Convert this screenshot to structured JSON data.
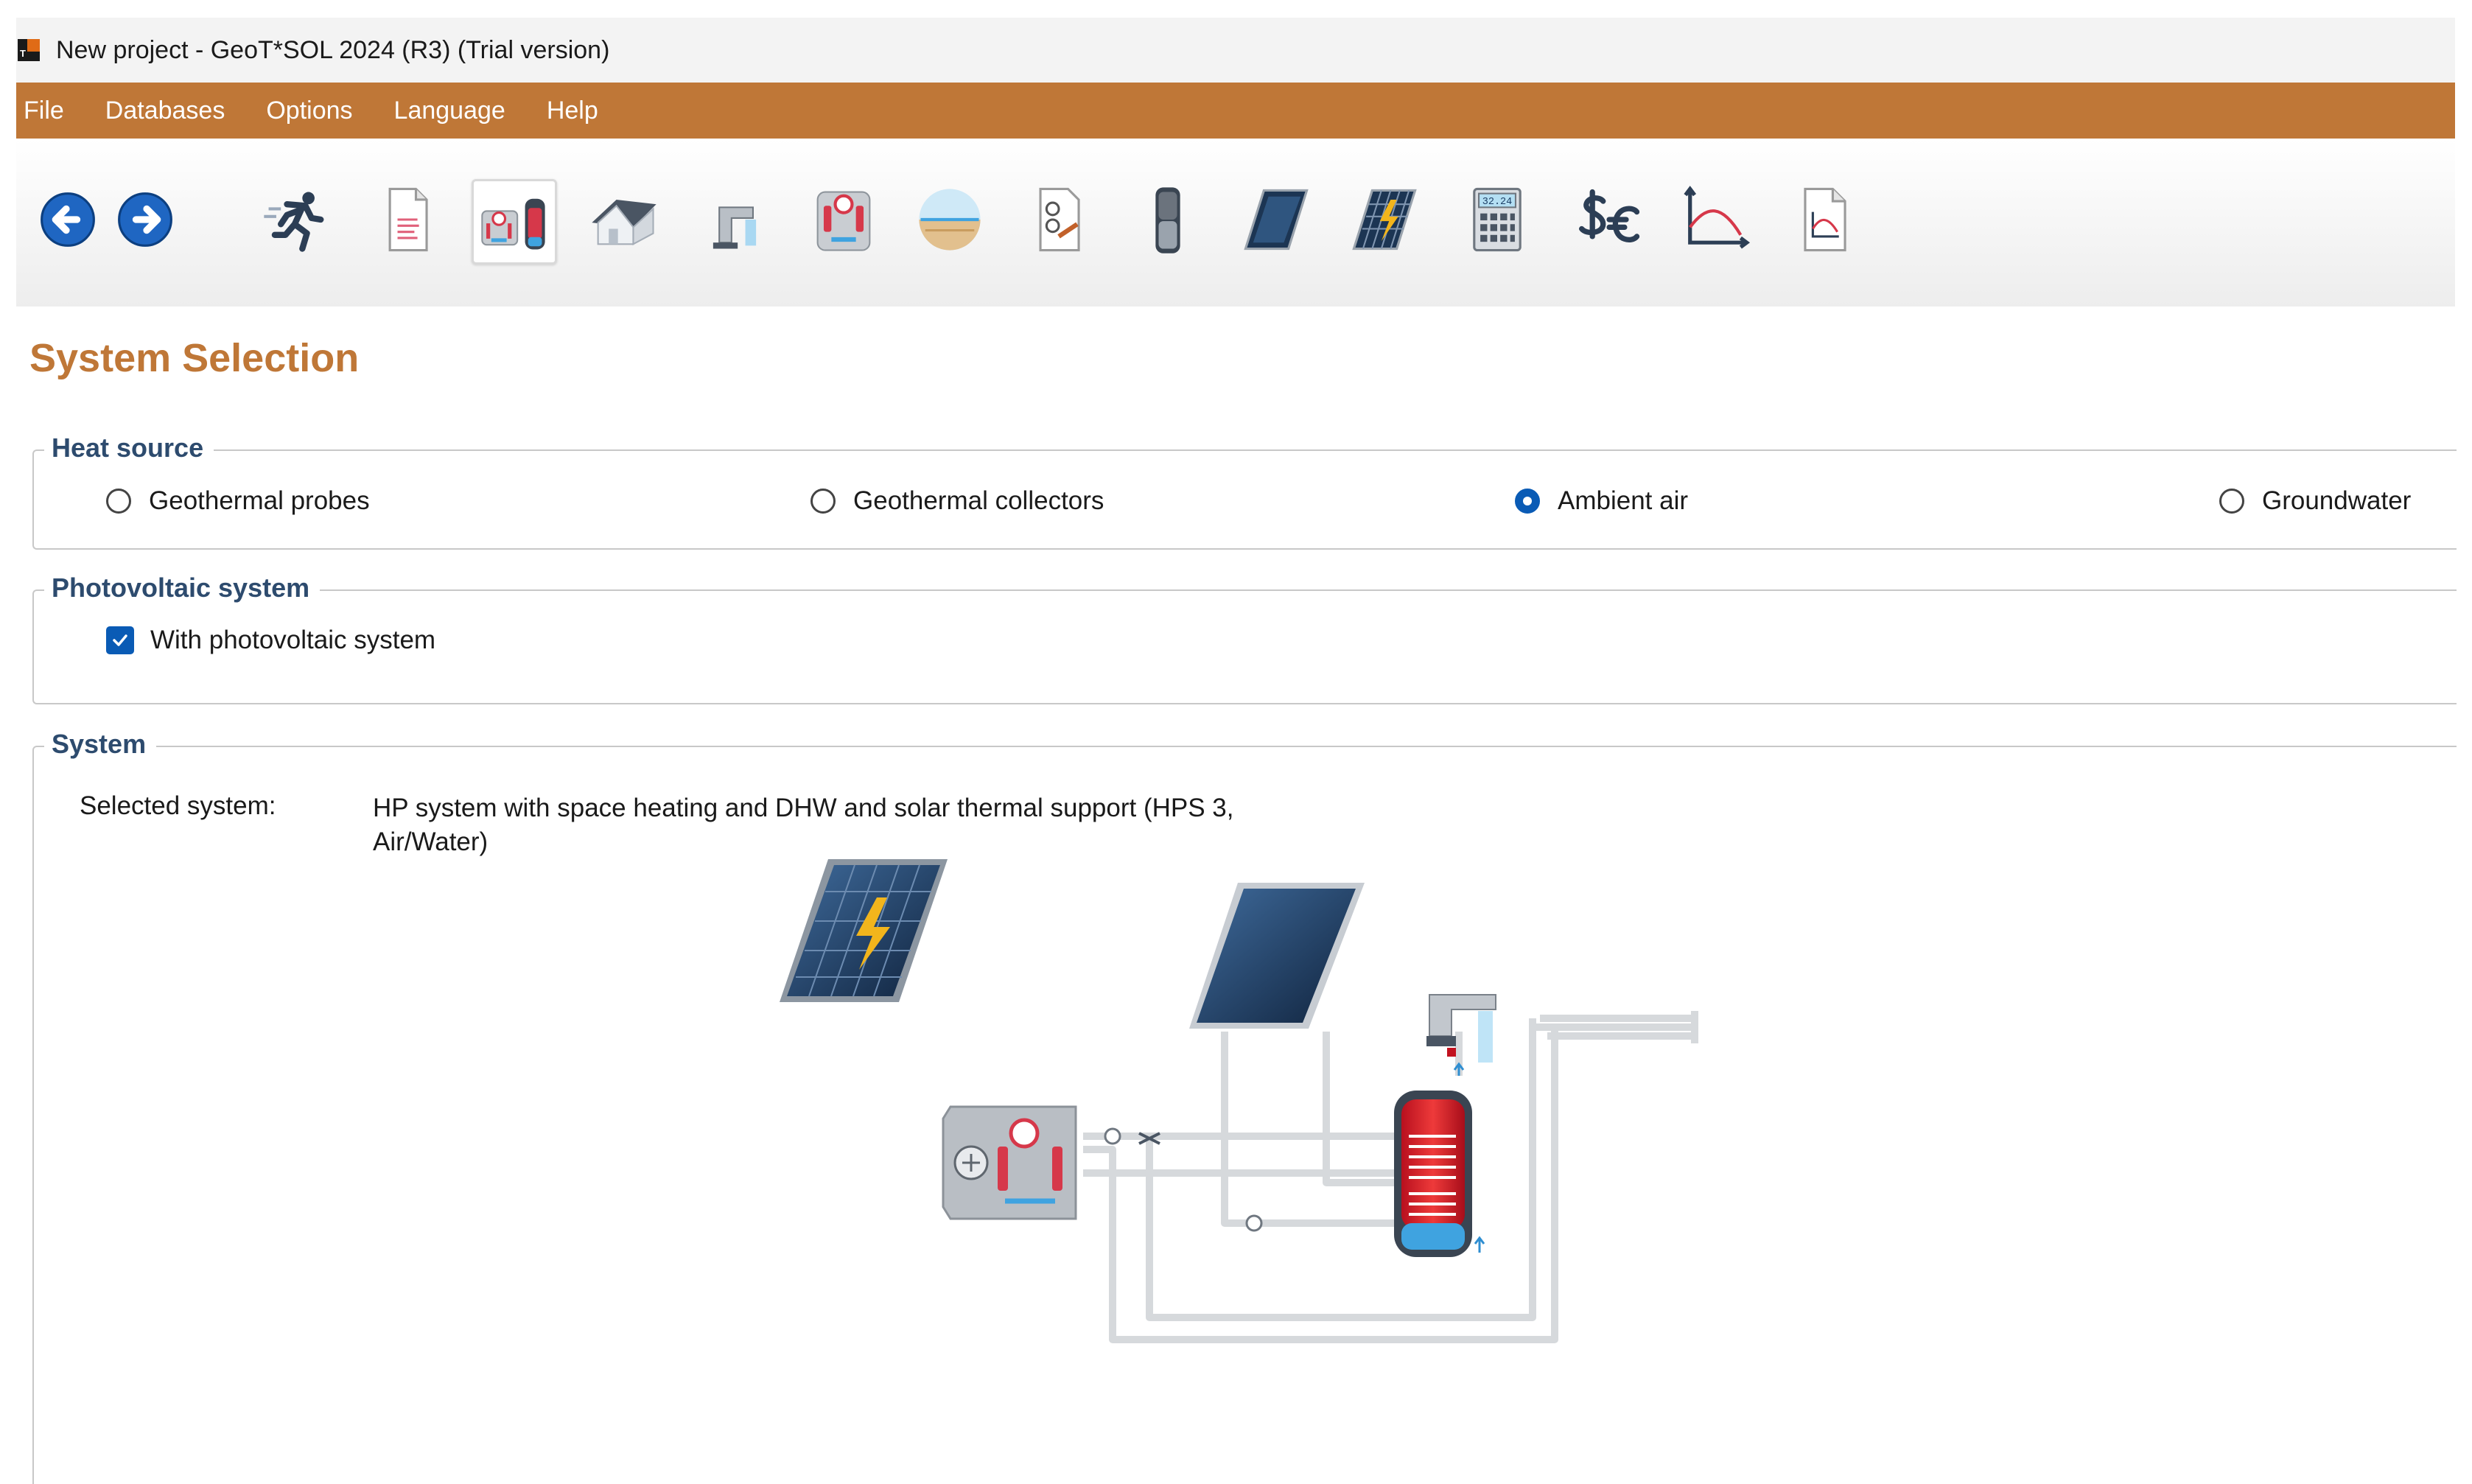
{
  "window": {
    "title": "New project - GeoT*SOL 2024 (R3) (Trial version)"
  },
  "menu": {
    "items": [
      "File",
      "Databases",
      "Options",
      "Language",
      "Help"
    ]
  },
  "toolbar": {
    "buttons": [
      "back-icon",
      "forward-icon",
      "quick-start-icon",
      "project-data-icon",
      "system-selection-icon",
      "building-icon",
      "hot-water-icon",
      "heat-pump-icon",
      "heat-source-icon",
      "tank-connection-icon",
      "storage-tank-icon",
      "solar-collector-icon",
      "pv-module-icon",
      "calculator-icon",
      "cost-icon",
      "chart-icon",
      "report-icon"
    ],
    "active": "system-selection-icon",
    "calculator_display": "32.24"
  },
  "page": {
    "heading": "System Selection"
  },
  "heat_source": {
    "label": "Heat source",
    "options": [
      "Geothermal probes",
      "Geothermal collectors",
      "Ambient air",
      "Groundwater"
    ],
    "selected": "Ambient air"
  },
  "photovoltaic": {
    "label": "Photovoltaic system",
    "checkbox_label": "With photovoltaic system",
    "checked": true
  },
  "system": {
    "label": "System",
    "selected_label": "Selected system:",
    "selected_value": "HP system with space heating and DHW and solar thermal support (HPS 3, Air/Water)"
  },
  "colors": {
    "accent": "#bf7737",
    "group_label": "#2d4b6e",
    "selection": "#0a5bb5"
  }
}
